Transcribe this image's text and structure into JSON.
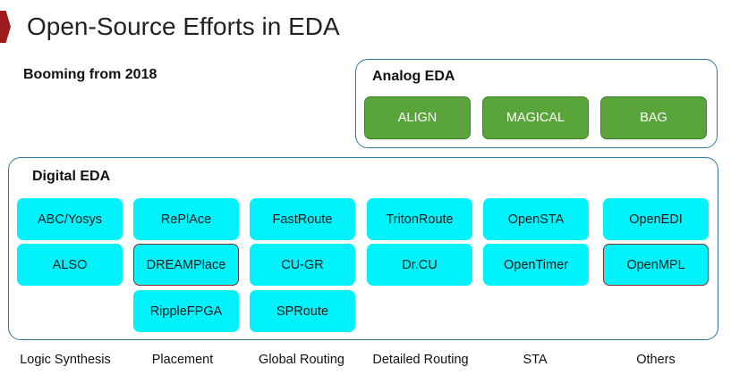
{
  "title": "Open-Source Efforts in EDA",
  "subtitle": "Booming from 2018",
  "analog": {
    "title": "Analog EDA",
    "items": [
      "ALIGN",
      "MAGICAL",
      "BAG"
    ]
  },
  "digital": {
    "title": "Digital EDA",
    "columns": [
      {
        "category": "Logic Synthesis",
        "items": [
          "ABC/Yosys",
          "ALSO"
        ]
      },
      {
        "category": "Placement",
        "items": [
          "RePlAce",
          "DREAMPlace",
          "RippleFPGA"
        ]
      },
      {
        "category": "Global Routing",
        "items": [
          "FastRoute",
          "CU-GR",
          "SPRoute"
        ]
      },
      {
        "category": "Detailed Routing",
        "items": [
          "TritonRoute",
          "Dr.CU"
        ]
      },
      {
        "category": "STA",
        "items": [
          "OpenSTA",
          "OpenTimer"
        ]
      },
      {
        "category": "Others",
        "items": [
          "OpenEDI",
          "OpenMPL"
        ]
      }
    ]
  },
  "colors": {
    "accent_marker": "#9e1b1b",
    "panel_border": "#2a7a9a",
    "analog_chip": "#5aa43c",
    "digital_chip": "#00f3fb",
    "highlight_border": "#8a2a2a"
  }
}
